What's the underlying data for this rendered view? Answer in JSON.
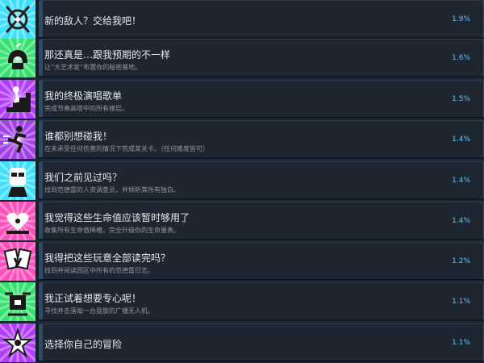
{
  "achievements": [
    {
      "title": "新的敌人？交给我吧！",
      "desc": "",
      "pct": "1.9%",
      "icon": "compass-burst-icon",
      "bg": "#3fe0ff",
      "fg": "#222222"
    },
    {
      "title": "那还真是…跟我预期的不一样",
      "desc": "让“大艺术家”布置你的秘密基地。",
      "pct": "1.6%",
      "icon": "phone-icon",
      "bg": "#38e070",
      "fg": "#1a1a1a"
    },
    {
      "title": "我的终极演唱歌单",
      "desc": "完成节奏高塔中的所有楼层。",
      "pct": "1.5%",
      "icon": "stairs-climber-icon",
      "bg": "#b23cff",
      "fg": "#1a1a1a"
    },
    {
      "title": "谁都别想碰我！",
      "desc": "在未承受任何伤害的情况下完成某关卡。（任何难度皆可）",
      "pct": "1.4%",
      "icon": "runner-icon",
      "bg": "#a040e6",
      "fg": "#1a1a1a"
    },
    {
      "title": "我们之前见过吗？",
      "desc": "找到范德雷的人资调查员，并倾听其所有独白。",
      "pct": "1.4%",
      "icon": "character-portrait-icon",
      "bg": "#3fe0ff",
      "fg": "#1a1a1a"
    },
    {
      "title": "我觉得这些生命值应该暂时够用了",
      "desc": "收集所有生命值稀槽，完全升级你的生命量表。",
      "pct": "1.4%",
      "icon": "heart-gauge-icon",
      "bg": "#ff4fb8",
      "fg": "#1a1a1a"
    },
    {
      "title": "我得把这些玩意全部读完吗？",
      "desc": "找到并阅读园区中所有的范德雷日志。",
      "pct": "1.2%",
      "icon": "cards-icon",
      "bg": "#ff4fb8",
      "fg": "#1a1a1a"
    },
    {
      "title": "我正试着想要专心呢！",
      "desc": "寻找并击落每一台盘旋的广播无人机。",
      "pct": "1.1%",
      "icon": "drone-icon",
      "bg": "#38e070",
      "fg": "#1a1a1a"
    },
    {
      "title": "选择你自己的冒险",
      "desc": "",
      "pct": "1.1%",
      "icon": "star-burst-icon",
      "bg": "#b23cff",
      "fg": "#1a1a1a"
    }
  ]
}
